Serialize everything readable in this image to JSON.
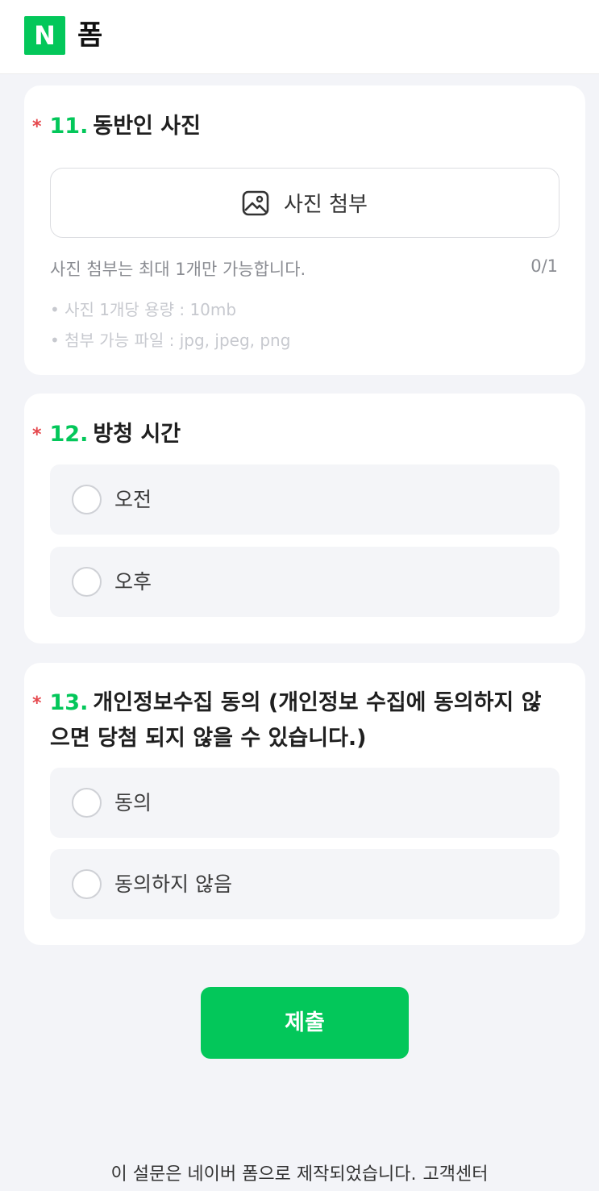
{
  "header": {
    "logo_letter": "N",
    "title": "폼"
  },
  "questions": [
    {
      "required_mark": "*",
      "number": "11.",
      "title": "동반인 사진",
      "attach_label": "사진 첨부",
      "note": "사진 첨부는 최대 1개만 가능합니다.",
      "count": "0/1",
      "bullets": [
        "• 사진 1개당 용량 : 10mb",
        "• 첨부 가능 파일 : jpg, jpeg, png"
      ]
    },
    {
      "required_mark": "*",
      "number": "12.",
      "title": "방청 시간",
      "options": [
        "오전",
        "오후"
      ]
    },
    {
      "required_mark": "*",
      "number": "13.",
      "title_line1": "개인정보수집 동의 (개인정보 수집에 동의하지 않",
      "title_line2": "으면 당첨 되지 않을 수 있습니다.)",
      "options": [
        "동의",
        "동의하지 않음"
      ]
    }
  ],
  "submit_label": "제출",
  "footer": {
    "text": "이 설문은 네이버 폼으로 제작되었습니다.",
    "link": "고객센터"
  },
  "colors": {
    "accent": "#03c75a",
    "required": "#e5484d"
  },
  "icons": {
    "attach": "image-icon",
    "radio": "radio-unchecked-icon"
  }
}
